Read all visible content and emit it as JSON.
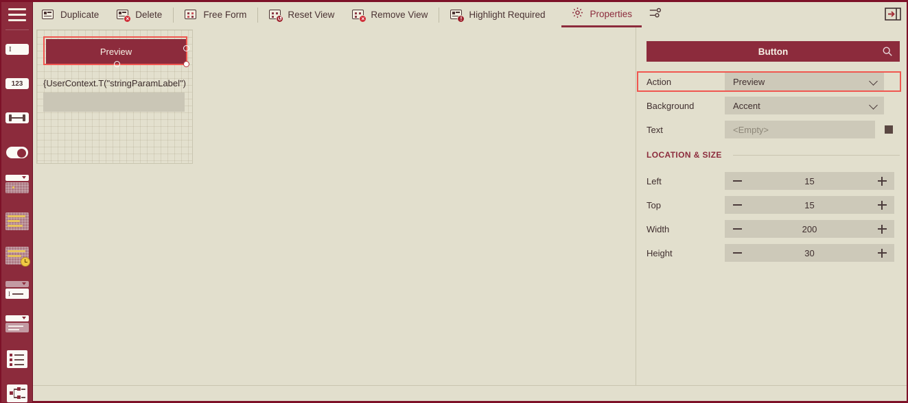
{
  "colors": {
    "accent": "#8c2b3c",
    "panel_bg": "#e2dfcd",
    "control_bg": "#cdc9b9",
    "highlight": "#f0564f",
    "text": "#3f2e2e",
    "swatch": "#5a4742"
  },
  "rail": {
    "menu_label": "menu",
    "items": [
      {
        "name": "text-input-tool",
        "icon": "textbox-icon",
        "glyph": "I"
      },
      {
        "name": "number-input-tool",
        "icon": "number-icon",
        "glyph": "123"
      },
      {
        "name": "range-slider-tool",
        "icon": "slider-icon",
        "glyph": ""
      },
      {
        "name": "toggle-tool",
        "icon": "toggle-icon",
        "glyph": ""
      },
      {
        "name": "dropdown-grid-tool",
        "icon": "combo-grid-icon",
        "glyph": ""
      },
      {
        "name": "data-grid-tool",
        "icon": "grid-icon",
        "glyph": ""
      },
      {
        "name": "schedule-grid-tool",
        "icon": "grid-clock-icon",
        "glyph": ""
      },
      {
        "name": "label-field-tool",
        "icon": "combo-label-icon",
        "glyph": ""
      },
      {
        "name": "text-area-tool",
        "icon": "combo-textarea-icon",
        "glyph": ""
      },
      {
        "name": "list-tool",
        "icon": "list-icon",
        "glyph": ""
      },
      {
        "name": "tree-tool",
        "icon": "tree-icon",
        "glyph": ""
      }
    ]
  },
  "toolbar": {
    "buttons": [
      {
        "label": "Duplicate",
        "icon": "duplicate-icon"
      },
      {
        "label": "Delete",
        "icon": "delete-icon"
      },
      {
        "label": "Free Form",
        "icon": "free-form-icon"
      },
      {
        "label": "Reset View",
        "icon": "reset-view-icon"
      },
      {
        "label": "Remove View",
        "icon": "remove-view-icon"
      },
      {
        "label": "Highlight Required",
        "icon": "highlight-required-icon"
      }
    ],
    "properties_tab": "Properties",
    "properties_icon": "gear-icon",
    "sliders_icon": "sliders-icon",
    "collapse_icon": "collapse-panel-icon"
  },
  "canvas": {
    "button_label": "Preview",
    "field_label": "{UserContext.T(\"stringParamLabel\")",
    "field_value": ""
  },
  "properties": {
    "header_title": "Button",
    "search_icon": "search-icon",
    "rows": [
      {
        "label": "Action",
        "value": "Preview",
        "type": "select",
        "highlighted": true
      },
      {
        "label": "Background",
        "value": "Accent",
        "type": "select",
        "highlighted": false
      },
      {
        "label": "Text",
        "value": "",
        "placeholder": "<Empty>",
        "type": "text-swatch",
        "highlighted": false
      }
    ],
    "section_title": "LOCATION & SIZE",
    "size_rows": [
      {
        "label": "Left",
        "value": "15"
      },
      {
        "label": "Top",
        "value": "15"
      },
      {
        "label": "Width",
        "value": "200"
      },
      {
        "label": "Height",
        "value": "30"
      }
    ],
    "minus_label": "decrease",
    "plus_label": "increase"
  }
}
